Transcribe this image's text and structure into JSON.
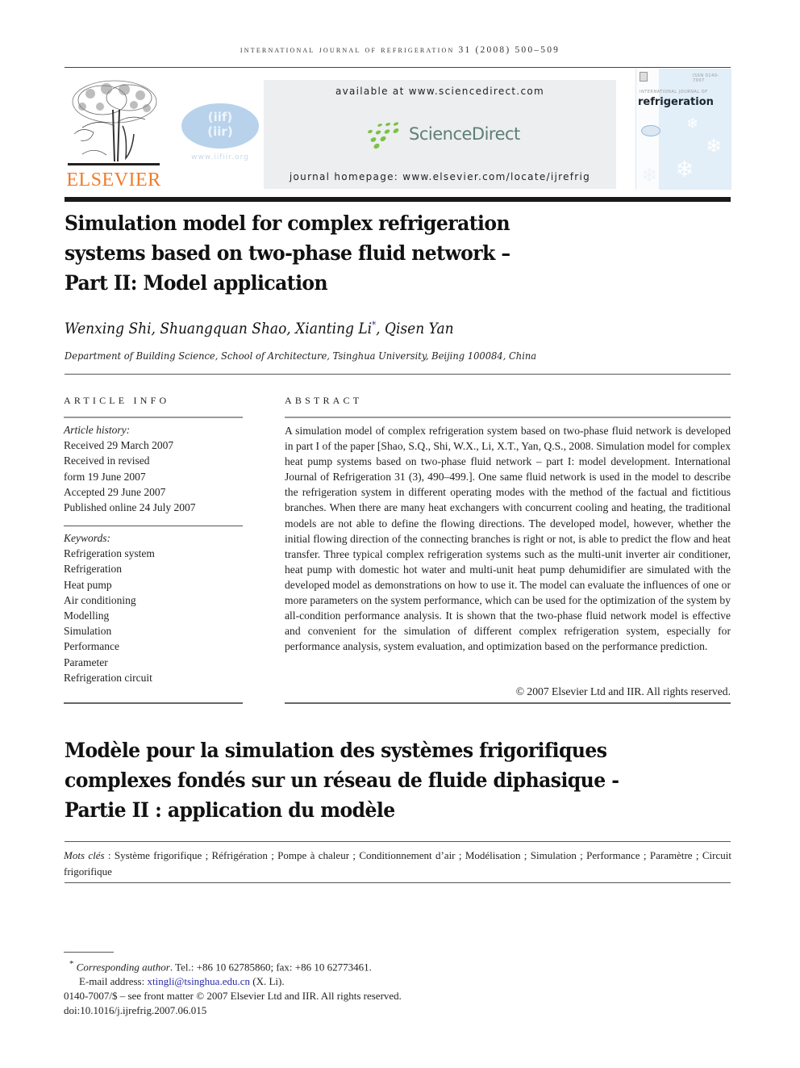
{
  "running_head": "INTERNATIONAL JOURNAL OF REFRIGERATION 31 (2008) 500–509",
  "header": {
    "publisher_logo": "ELSEVIER",
    "iir_logo_lines": [
      "(iif)",
      "(iir)"
    ],
    "iir_url": "www.iifiir.org",
    "available_at": "available at www.sciencedirect.com",
    "sciencedirect_logo": "ScienceDirect",
    "journal_homepage": "journal homepage: www.elsevier.com/locate/ijrefrig",
    "cover": {
      "issn": "ISSN 0140-7007",
      "subtitle": "INTERNATIONAL JOURNAL OF",
      "title": "refrigeration"
    },
    "colors": {
      "elsevier_orange": "#f07b2a",
      "sciencedirect_green": "#7cc242",
      "sciencedirect_text": "#5f7f73",
      "iir_blue": "#b8d2ec",
      "link_blue": "#2a2aa8"
    }
  },
  "article": {
    "title_lines": [
      "Simulation model for complex refrigeration",
      "systems based on two-phase fluid network –",
      "Part II: Model application"
    ],
    "authors": {
      "before_marker": "Wenxing Shi, Shuangquan Shao, Xianting Li",
      "marker": "*",
      "after_marker": ", Qisen Yan"
    },
    "affiliation": "Department of Building Science, School of Architecture, Tsinghua University, Beijing 100084, China"
  },
  "article_info": {
    "heading": "ARTICLE INFO",
    "history_label": "Article history:",
    "history": [
      "Received 29 March 2007",
      "Received in revised",
      "form 19 June 2007",
      "Accepted 29 June 2007",
      "Published online 24 July 2007"
    ],
    "keywords_label": "Keywords:",
    "keywords": [
      "Refrigeration system",
      "Refrigeration",
      "Heat pump",
      "Air conditioning",
      "Modelling",
      "Simulation",
      "Performance",
      "Parameter",
      "Refrigeration circuit"
    ]
  },
  "abstract": {
    "heading": "ABSTRACT",
    "text": "A simulation model of complex refrigeration system based on two-phase fluid network is developed in part I of the paper [Shao, S.Q., Shi, W.X., Li, X.T., Yan, Q.S., 2008. Simulation model for complex heat pump systems based on two-phase fluid network – part I: model development. International Journal of Refrigeration 31 (3), 490–499.]. One same fluid net­work is used in the model to describe the refrigeration system in different operating modes with the method of the factual and fictitious branches. When there are many heat ex­changers with concurrent cooling and heating, the traditional models are not able to define the flowing directions. The developed model, however, whether the initial flowing direc­tion of the connecting branches is right or not, is able to predict the flow and heat transfer. Three typical complex refrigeration systems such as the multi-unit inverter air conditioner, heat pump with domestic hot water and multi-unit heat pump dehumidifier are simulated with the developed model as demonstrations on how to use it. The model can evaluate the influences of one or more parameters on the system performance, which can be used for the optimization of the system by all-condition performance analysis. It is shown that the two-phase fluid network model is effective and convenient for the simulation of different complex refrigeration system, especially for performance analysis, system evaluation, and optimization based on the performance prediction.",
    "copyright": "© 2007 Elsevier Ltd and IIR. All rights reserved."
  },
  "french": {
    "title_lines": [
      "Modèle pour la simulation des systèmes frigorifiques",
      "complexes fondés sur un réseau de fluide diphasique -",
      "Partie II : application du modèle"
    ],
    "keywords_label": "Mots clés",
    "keywords_text": " : Système frigorifique ; Réfrigération ; Pompe à chaleur ; Conditionnement d’air ; Modélisation ; Simulation ; Performance ; Paramètre ; Circuit frigorifique"
  },
  "footnotes": {
    "marker": "*",
    "corresponding_label": "Corresponding author",
    "contact": ". Tel.: +86 10 62785860; fax: +86 10 62773461.",
    "email_label": "E-mail address: ",
    "email": "xtingli@tsinghua.edu.cn",
    "email_suffix": " (X. Li).",
    "front_matter": "0140-7007/$ – see front matter © 2007 Elsevier Ltd and IIR. All rights reserved.",
    "doi": "doi:10.1016/j.ijrefrig.2007.06.015"
  }
}
